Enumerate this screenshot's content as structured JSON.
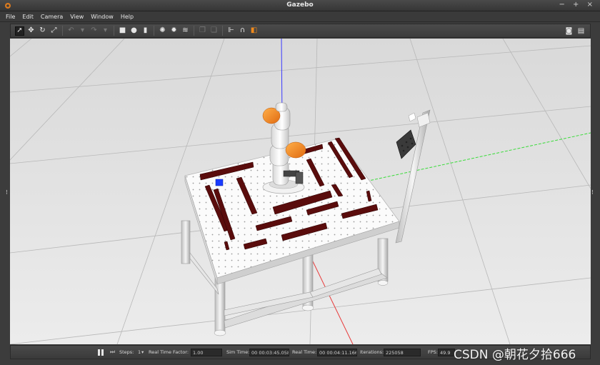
{
  "window": {
    "title": "Gazebo",
    "controls": "− + ×"
  },
  "menu": [
    "File",
    "Edit",
    "Camera",
    "View",
    "Window",
    "Help"
  ],
  "toolbar": {
    "left_icons": [
      "select-arrow-icon",
      "translate-icon",
      "rotate-icon",
      "scale-icon",
      "undo-icon",
      "undo-dropdown-icon",
      "redo-icon",
      "redo-dropdown-icon",
      "box-shape-icon",
      "sphere-shape-icon",
      "cylinder-shape-icon",
      "point-light-icon",
      "spot-light-icon",
      "directional-light-icon",
      "copy-icon",
      "paste-icon",
      "align-icon",
      "snap-icon",
      "change-view-icon"
    ],
    "right_icons": [
      "screenshot-icon",
      "log-icon"
    ]
  },
  "status": {
    "steps_label": "Steps:",
    "steps_value": "1",
    "rtf_label": "Real Time Factor:",
    "rtf_value": "1.00",
    "sim_time_label": "Sim Time:",
    "sim_time_value": "00 00:03:45.058",
    "real_time_label": "Real Time:",
    "real_time_value": "00 00:04:11.166",
    "iterations_label": "Iterations:",
    "iterations_value": "225058",
    "fps_label": "FPS:",
    "fps_value": "49.9"
  },
  "watermark": "CSDN @朝花夕拾666",
  "colors": {
    "window_chrome": "#3c3c3c",
    "viewport_bg": "#e4e4e4",
    "maze_wall": "#5a0c0c",
    "robot_accent": "#f08a1c",
    "axis_x": "#e83a3a",
    "axis_y": "#3adc3a",
    "axis_z": "#3a3aff",
    "target_cube": "#1a3cff"
  }
}
